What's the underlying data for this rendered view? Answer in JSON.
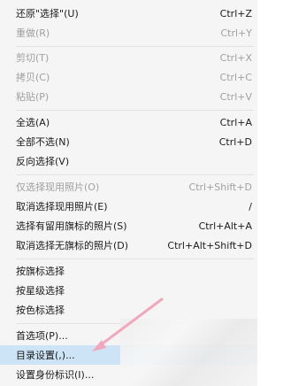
{
  "menu": {
    "items": [
      {
        "label": "还原\"选择\"(U)",
        "shortcut": "Ctrl+Z",
        "disabled": false
      },
      {
        "label": "重做(R)",
        "shortcut": "Ctrl+Y",
        "disabled": true
      },
      {
        "label": "剪切(T)",
        "shortcut": "Ctrl+X",
        "disabled": true
      },
      {
        "label": "拷贝(C)",
        "shortcut": "Ctrl+C",
        "disabled": true
      },
      {
        "label": "粘贴(P)",
        "shortcut": "Ctrl+V",
        "disabled": true
      },
      {
        "label": "全选(A)",
        "shortcut": "Ctrl+A",
        "disabled": false
      },
      {
        "label": "全部不选(N)",
        "shortcut": "Ctrl+D",
        "disabled": false
      },
      {
        "label": "反向选择(V)",
        "shortcut": "",
        "disabled": false
      },
      {
        "label": "仅选择现用照片(O)",
        "shortcut": "Ctrl+Shift+D",
        "disabled": true
      },
      {
        "label": "取消选择现用照片(E)",
        "shortcut": "/",
        "disabled": false
      },
      {
        "label": "选择有留用旗标的照片(S)",
        "shortcut": "Ctrl+Alt+A",
        "disabled": false
      },
      {
        "label": "取消选择无旗标的照片(D)",
        "shortcut": "Ctrl+Alt+Shift+D",
        "disabled": false
      },
      {
        "label": "按旗标选择",
        "shortcut": "",
        "disabled": false
      },
      {
        "label": "按星级选择",
        "shortcut": "",
        "disabled": false
      },
      {
        "label": "按色标选择",
        "shortcut": "",
        "disabled": false
      },
      {
        "label": "首选项(P)...",
        "shortcut": "",
        "disabled": false
      },
      {
        "label": "目录设置(,)...",
        "shortcut": "",
        "disabled": false
      },
      {
        "label": "设置身份标识(I)...",
        "shortcut": "",
        "disabled": false
      }
    ]
  },
  "colors": {
    "menu_bg": "#f5f5f5",
    "highlight": "#cde4f7",
    "arrow": "#f0a0b8",
    "disabled_text": "#a0a0a0"
  }
}
